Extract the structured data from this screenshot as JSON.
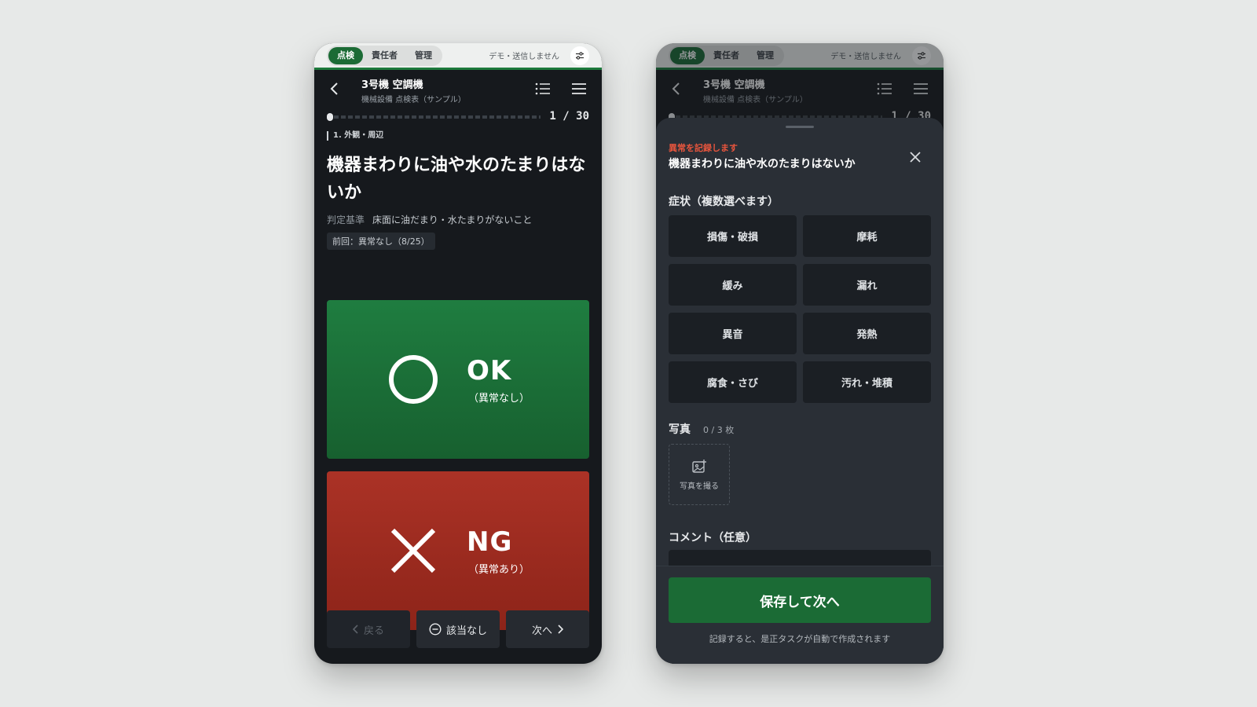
{
  "modebar": {
    "tabs": [
      "点検",
      "責任者",
      "管理"
    ],
    "active_tab": "点検",
    "demo_note": "デモ・送信しません"
  },
  "header": {
    "title": "3号機 空調機",
    "subtitle": "機械設備 点検表（サンプル）"
  },
  "progress": {
    "current": 1,
    "total": 30,
    "label": "1 / 30"
  },
  "item": {
    "section": "1. 外観・周辺",
    "question": "機器まわりに油や水のたまりはないか",
    "criteria_label": "判定基準",
    "criteria_text": "床面に油だまり・水たまりがないこと",
    "previous": "前回：異常なし（8/25）"
  },
  "answers": {
    "ok_main": "OK",
    "ok_sub": "（異常なし）",
    "ng_main": "NG",
    "ng_sub": "（異常あり）"
  },
  "footer": {
    "back": "戻る",
    "na": "該当なし",
    "next": "次へ"
  },
  "sheet": {
    "label": "異常を記録します",
    "question": "機器まわりに油や水のたまりはないか",
    "symptom_title": "症状（複数選べます）",
    "symptoms": [
      "損傷・破損",
      "摩耗",
      "緩み",
      "漏れ",
      "異音",
      "発熱",
      "腐食・さび",
      "汚れ・堆積"
    ],
    "photo_title": "写真",
    "photo_count": "0 / 3 枚",
    "photo_button": "写真を撮る",
    "comment_title": "コメント（任意）",
    "save_button": "保存して次へ",
    "save_note": "記録すると、是正タスクが自動で作成されます"
  },
  "colors": {
    "accent_green": "#1b6b35",
    "ok_green": "#1f7d40",
    "ng_red": "#ab3226",
    "alert_red": "#e8553d"
  }
}
